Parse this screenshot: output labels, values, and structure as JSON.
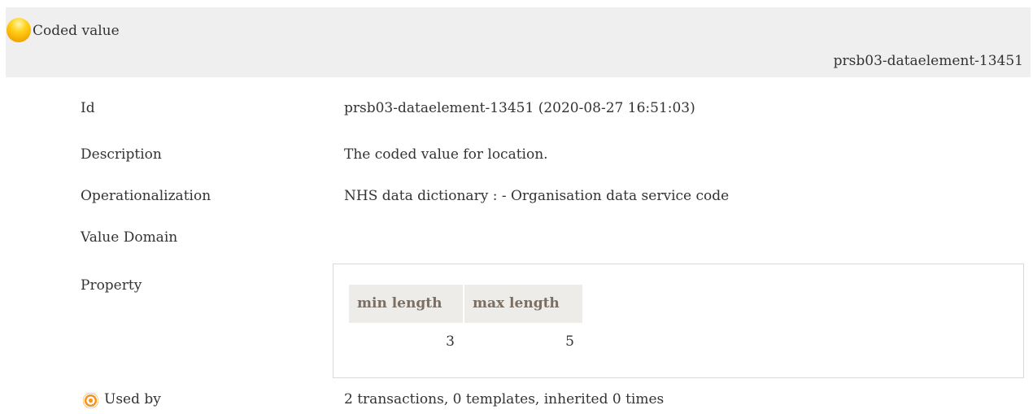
{
  "header": {
    "title": "Coded value",
    "element_id": "prsb03-dataelement-13451",
    "status_icon": "yellow-circle-icon",
    "status_color": "#f6b300"
  },
  "details": {
    "id": {
      "label": "Id",
      "value": "prsb03-dataelement-13451 (2020-08-27 16:51:03)"
    },
    "description": {
      "label": "Description",
      "value": "The coded value for location."
    },
    "operationalization": {
      "label": "Operationalization",
      "value": "NHS data dictionary : - Organisation data service code"
    },
    "value_domain": {
      "label": "Value Domain"
    },
    "property": {
      "label": "Property",
      "columns": [
        "min length",
        "max length"
      ],
      "values": [
        "3",
        "5"
      ]
    },
    "used_by": {
      "icon": "target-icon",
      "icon_color": "#f7941d",
      "label": "Used by",
      "value": "2 transactions, 0 templates, inherited 0 times"
    }
  }
}
